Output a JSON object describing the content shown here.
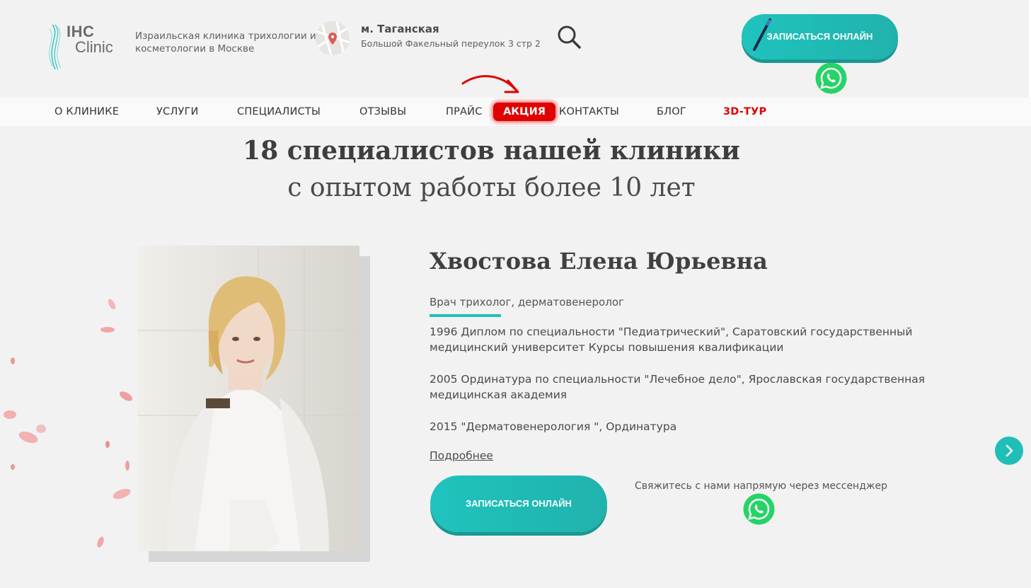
{
  "header": {
    "logo_line1": "IHC",
    "logo_line2": "Clinic",
    "tagline": "Израильская клиника трихологии и косметологии в Москве",
    "metro": "м. Таганская",
    "address": "Большой Факельный переулок 3 стр 2",
    "cta_label": "ЗАПИСАТЬСЯ ОНЛАЙН"
  },
  "nav": {
    "items": [
      "О КЛИНИКЕ",
      "УСЛУГИ",
      "СПЕЦИАЛИСТЫ",
      "ОТЗЫВЫ",
      "ПРАЙС",
      "АКЦИЯ",
      "КОНТАКТЫ",
      "БЛОГ",
      "3D-ТУР"
    ]
  },
  "section": {
    "title": "18 специалистов нашей клиники",
    "subtitle": "с опытом работы более 10 лет"
  },
  "doctor": {
    "name": "Хвостова Елена Юрьевна",
    "role": "Врач трихолог, дерматовенеролог",
    "education": [
      "1996 Диплом по специальности \"Педиатрический\", Саратовский государственный медицинский университет Курсы повышения квалификации",
      "2005 Ординатура по специальности \"Лечебное дело\", Ярославская государственная медицинская академия",
      "2015 \"Дерматовенерология \", Ординатура"
    ],
    "more_link": "Подробнее",
    "cta_label": "ЗАПИСАТЬСЯ ОНЛАЙН",
    "messenger_text": "Свяжитесь с нами напрямую через мессенджер"
  },
  "colors": {
    "accent": "#1fc3bd",
    "promo": "#e00000",
    "whatsapp": "#25d366"
  },
  "icons": [
    "search-icon",
    "whatsapp-icon",
    "pen-icon",
    "chevron-right-icon",
    "map-pin-icon"
  ]
}
